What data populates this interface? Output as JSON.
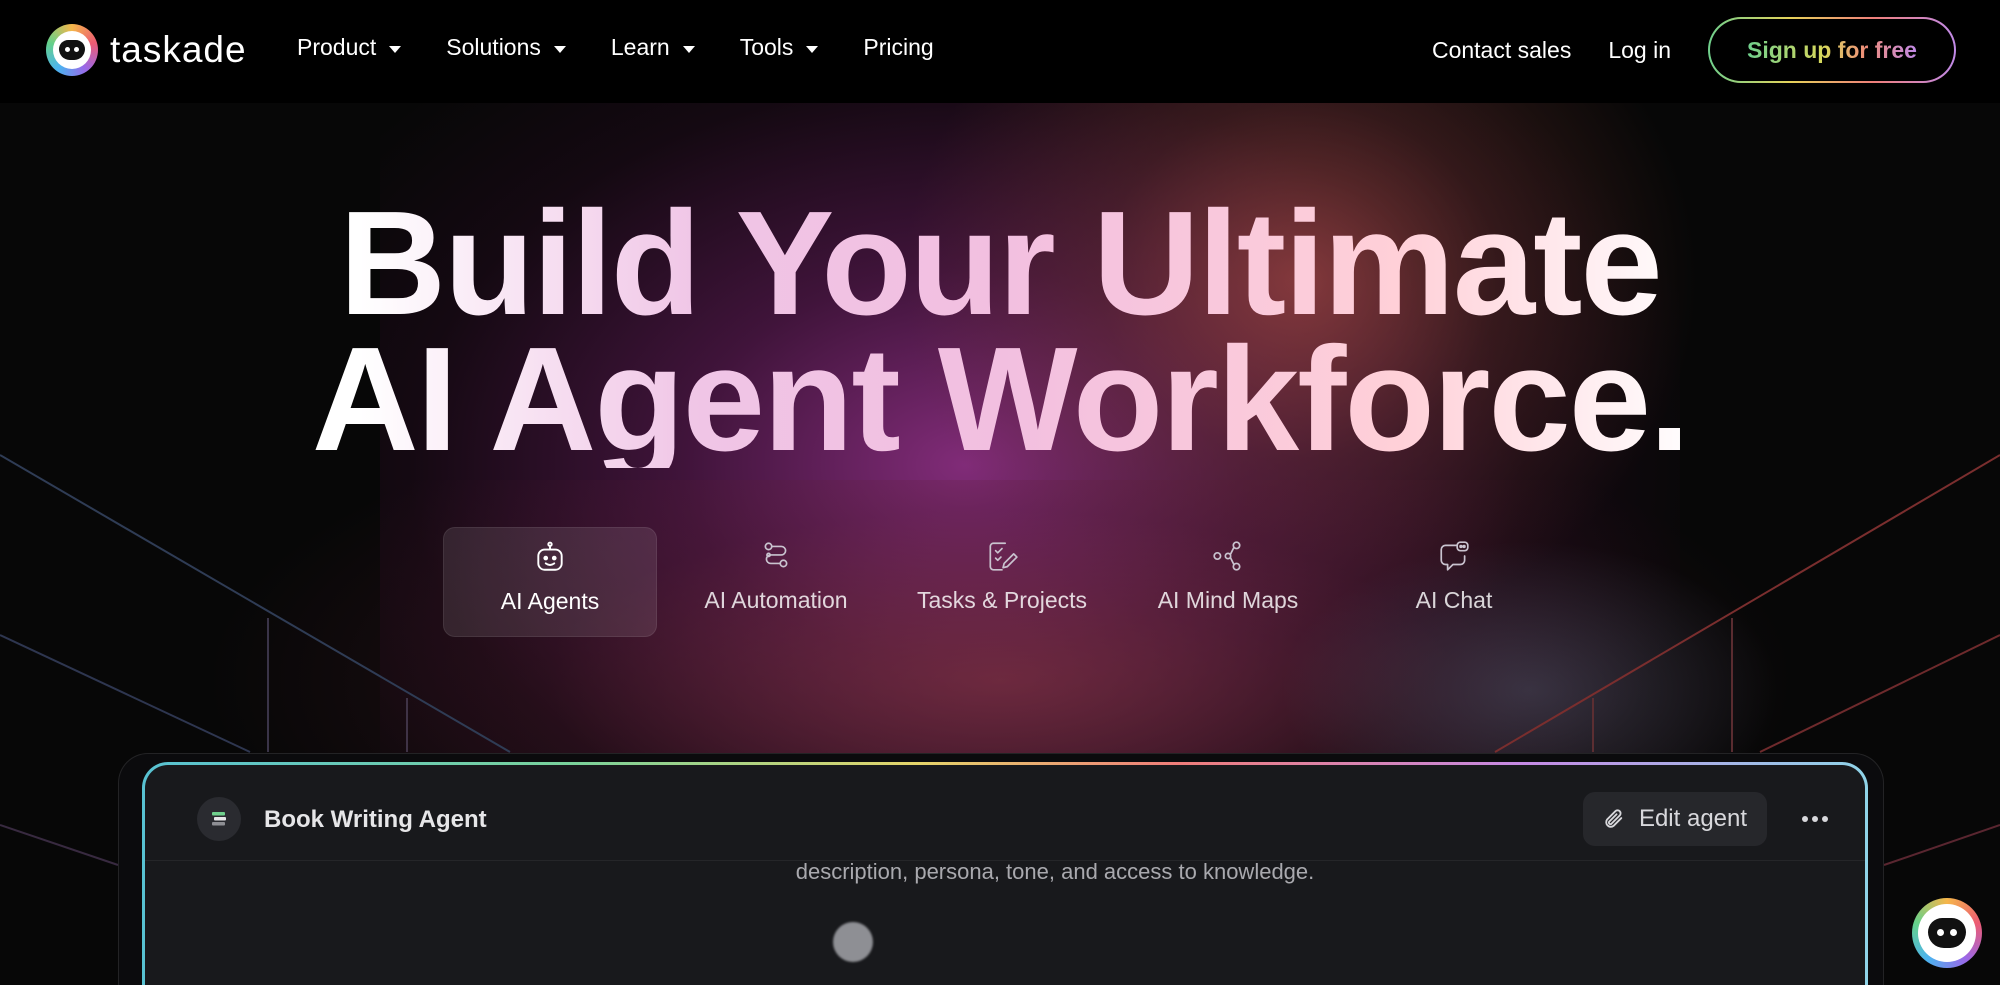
{
  "nav": {
    "logo_text": "taskade",
    "menu": [
      {
        "label": "Product"
      },
      {
        "label": "Solutions"
      },
      {
        "label": "Learn"
      },
      {
        "label": "Tools"
      }
    ],
    "pricing": "Pricing",
    "contact_sales": "Contact sales",
    "login": "Log in",
    "signup": "Sign up for free"
  },
  "hero": {
    "line1": "Build Your Ultimate",
    "line2": "AI Agent Workforce."
  },
  "tabs": [
    {
      "label": "AI Agents",
      "icon": "robot-icon",
      "active": true
    },
    {
      "label": "AI Automation",
      "icon": "workflow-icon",
      "active": false
    },
    {
      "label": "Tasks & Projects",
      "icon": "task-edit-icon",
      "active": false
    },
    {
      "label": "AI Mind Maps",
      "icon": "mind-map-icon",
      "active": false
    },
    {
      "label": "AI Chat",
      "icon": "chat-bot-icon",
      "active": false
    }
  ],
  "preview": {
    "agent_title": "Book Writing Agent",
    "edit_label": "Edit agent",
    "description": "description, persona, tone, and access to knowledge."
  },
  "colors": {
    "background": "#070707",
    "nav_bg": "#000000",
    "glow_purple": "#96328c",
    "glow_red": "#aa4b46",
    "preview_bg": "#18191c"
  }
}
